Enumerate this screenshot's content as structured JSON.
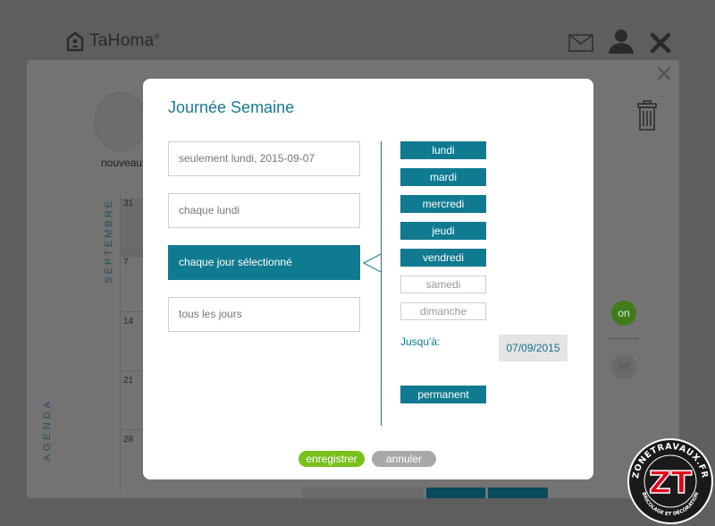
{
  "app": {
    "logo_text": "TaHoma",
    "logo_mark": "®"
  },
  "background": {
    "nouveau_label": "nouveau",
    "month_label": "SEPTEMBRE",
    "agenda_label": "AGENDA",
    "calendar_days": [
      "31",
      "7",
      "14",
      "21",
      "28"
    ],
    "toggle_on": "on",
    "toggle_off": "off"
  },
  "modal": {
    "title": "Journée Semaine",
    "options": [
      {
        "label": "seulement lundi, 2015-09-07",
        "selected": false
      },
      {
        "label": "chaque lundi",
        "selected": false
      },
      {
        "label": "chaque jour sélectionné",
        "selected": true
      },
      {
        "label": "tous les jours",
        "selected": false
      }
    ],
    "days": [
      {
        "label": "lundi",
        "active": true
      },
      {
        "label": "mardi",
        "active": true
      },
      {
        "label": "mercredi",
        "active": true
      },
      {
        "label": "jeudi",
        "active": true
      },
      {
        "label": "vendredi",
        "active": true
      },
      {
        "label": "samedi",
        "active": false
      },
      {
        "label": "dimanche",
        "active": false
      }
    ],
    "until_label": "Jusqu'à:",
    "until_date": "07/09/2015",
    "permanent_label": "permanent",
    "save_label": "enregistrer",
    "cancel_label": "annuler"
  },
  "watermark": {
    "top_text": "ZONETRAVAUX.FR",
    "bottom_text": "BRICOLAGE ET DÉCORATION",
    "mark": "ZT"
  },
  "colors": {
    "accent": "#0f7a90",
    "save": "#78c11b",
    "cancel": "#a9a9a9",
    "overlay": "#5e5e5e"
  }
}
